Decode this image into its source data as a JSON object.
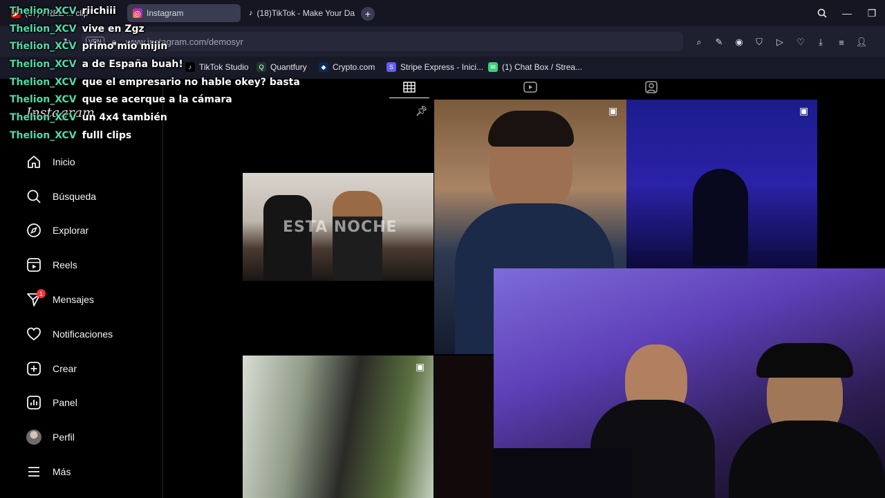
{
  "browser": {
    "tabs": [
      {
        "label": "(37) FREE ... clip",
        "icon": "youtube-icon",
        "active": false
      },
      {
        "label": "Instagram",
        "icon": "instagram-icon",
        "active": true
      },
      {
        "label": "(18)TikTok - Make Your Da",
        "icon": "tiktok-icon",
        "active": false
      }
    ],
    "vpn_label": "VPN",
    "url": "www.instagram.com/demosyr",
    "bookmarks": [
      {
        "label": "TikTok Studio",
        "icon": "tiktok-icon",
        "color": "#000000"
      },
      {
        "label": "Quantfury",
        "icon": "quantfury-icon",
        "color": "#1c3a2a"
      },
      {
        "label": "Crypto.com",
        "icon": "crypto-icon",
        "color": "#0b2a5a"
      },
      {
        "label": "Stripe Express - Inici...",
        "icon": "stripe-icon",
        "color": "#635bff"
      },
      {
        "label": "(1) Chat Box / Strea...",
        "icon": "chatbox-icon",
        "color": "#3ad07a"
      }
    ]
  },
  "instagram": {
    "logo": "Instagram",
    "nav": [
      {
        "label": "Inicio",
        "icon": "home-icon"
      },
      {
        "label": "Búsqueda",
        "icon": "search-icon"
      },
      {
        "label": "Explorar",
        "icon": "compass-icon"
      },
      {
        "label": "Reels",
        "icon": "reels-icon"
      },
      {
        "label": "Mensajes",
        "icon": "messages-icon",
        "badge": "1"
      },
      {
        "label": "Notificaciones",
        "icon": "heart-icon"
      },
      {
        "label": "Crear",
        "icon": "plus-icon"
      },
      {
        "label": "Panel",
        "icon": "chart-icon"
      },
      {
        "label": "Perfil",
        "icon": "avatar-icon"
      },
      {
        "label": "Más",
        "icon": "menu-icon"
      }
    ],
    "post_overlay_text": "ESTA NOCHE"
  },
  "chat": [
    {
      "user": "Thelion_XCV",
      "message": "riichiii"
    },
    {
      "user": "Thelion_XCV",
      "message": "vive en Zgz"
    },
    {
      "user": "Thelion_XCV",
      "message": "primo mio mijin"
    },
    {
      "user": "Thelion_XCV",
      "message": "a de España buah!"
    },
    {
      "user": "Thelion_XCV",
      "message": "que el empresario no hable okey? basta"
    },
    {
      "user": "Thelion_XCV",
      "message": "que se acerque a la cámara"
    },
    {
      "user": "Thelion_XCV",
      "message": "un 4x4 también"
    },
    {
      "user": "Thelion_XCV",
      "message": "fulll clips"
    }
  ],
  "colors": {
    "chat_user": "#4fdca8",
    "badge": "#ff3040",
    "tab_active": "#3a3c52"
  }
}
